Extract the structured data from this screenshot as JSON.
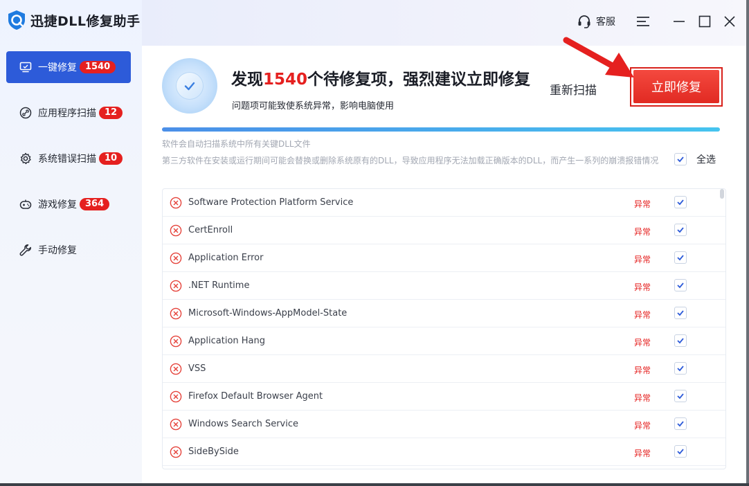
{
  "app": {
    "title": "迅捷DLL修复助手"
  },
  "titlebar": {
    "support_label": "客服"
  },
  "sidebar": {
    "items": [
      {
        "label": "一键修复",
        "badge": "1540",
        "icon": "monitor-icon",
        "active": true
      },
      {
        "label": "应用程序扫描",
        "badge": "12",
        "icon": "link-icon",
        "active": false
      },
      {
        "label": "系统错误扫描",
        "badge": "10",
        "icon": "gear-icon",
        "active": false
      },
      {
        "label": "游戏修复",
        "badge": "364",
        "icon": "gamepad-icon",
        "active": false
      },
      {
        "label": "手动修复",
        "badge": "",
        "icon": "wrench-icon",
        "active": false
      }
    ]
  },
  "header": {
    "headline_prefix": "发现",
    "headline_count": "1540",
    "headline_suffix": "个待修复项，强烈建议立即修复",
    "subline": "问题项可能致使系统异常，影响电脑使用",
    "rescan_label": "重新扫描",
    "fix_label": "立即修复"
  },
  "progress": {
    "value": 1.0
  },
  "notes": {
    "line1": "软件会自动扫描系统中所有关键DLL文件",
    "line2": "第三方软件在安装或运行期间可能会替换或删除系统原有的DLL，导致应用程序无法加载正确版本的DLL，而产生一系列的崩溃报错情况"
  },
  "select_all": {
    "label": "全选",
    "checked": true
  },
  "items": [
    {
      "name": "Software Protection Platform Service",
      "status": "异常",
      "checked": true
    },
    {
      "name": "CertEnroll",
      "status": "异常",
      "checked": true
    },
    {
      "name": "Application Error",
      "status": "异常",
      "checked": true
    },
    {
      "name": ".NET Runtime",
      "status": "异常",
      "checked": true
    },
    {
      "name": "Microsoft-Windows-AppModel-State",
      "status": "异常",
      "checked": true
    },
    {
      "name": "Application Hang",
      "status": "异常",
      "checked": true
    },
    {
      "name": "VSS",
      "status": "异常",
      "checked": true
    },
    {
      "name": "Firefox Default Browser Agent",
      "status": "异常",
      "checked": true
    },
    {
      "name": "Windows Search Service",
      "status": "异常",
      "checked": true
    },
    {
      "name": "SideBySide",
      "status": "异常",
      "checked": true
    }
  ],
  "colors": {
    "accent": "#2d5bd9",
    "danger": "#e5201f",
    "badge": "#e5201f"
  }
}
